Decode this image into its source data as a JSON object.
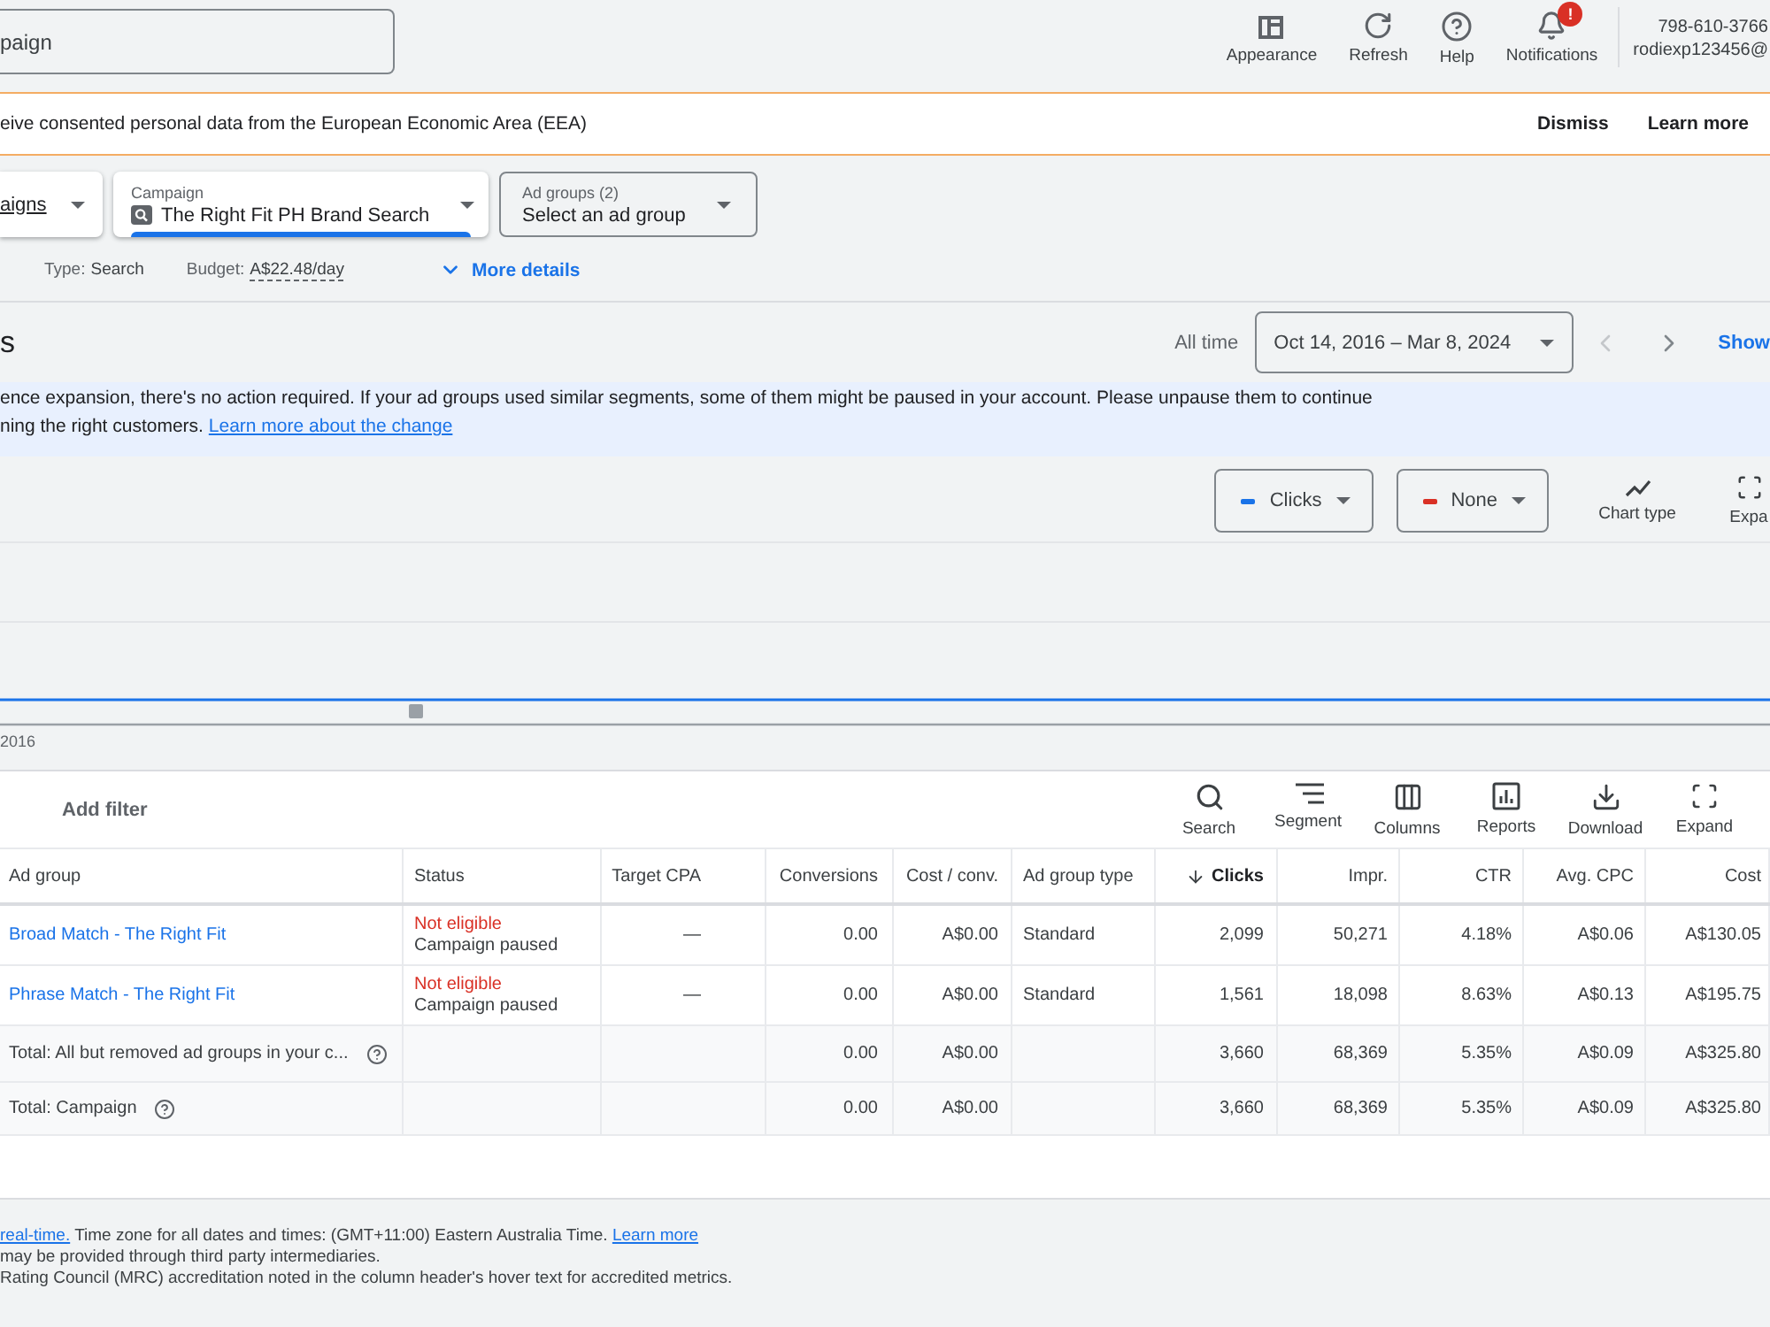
{
  "top_bar": {
    "search": {
      "value": "paign"
    },
    "actions": [
      {
        "label": "Appearance"
      },
      {
        "label": "Refresh"
      },
      {
        "label": "Help"
      },
      {
        "label": "Notifications",
        "badge": "!"
      }
    ],
    "account": {
      "customer_id": "798-610-3766",
      "email": "rodiexp123456@"
    }
  },
  "consent_banner": {
    "text": "eive consented personal data from the European Economic Area (EEA)",
    "actions": [
      "Dismiss",
      "Learn more"
    ]
  },
  "selectors": [
    {
      "kind": "link",
      "value": "aigns",
      "selected": false
    },
    {
      "kind": "chosen",
      "label": "Campaign",
      "value": "The Right Fit PH Brand Search",
      "selected": true
    },
    {
      "kind": "empty",
      "label": "Ad groups (2)",
      "value": "Select an ad group",
      "selected": false
    }
  ],
  "campaign_info": {
    "items": [
      {
        "kind": "text",
        "label": "Type:",
        "value": "Search"
      },
      {
        "kind": "editable",
        "label": "Budget:",
        "value": "A$22.48/day"
      }
    ],
    "more_details": "More details"
  },
  "page_header": {
    "title": "s",
    "range_label": "All time",
    "date_range": "Oct 14, 2016 – Mar 8, 2024",
    "prev_disabled": true,
    "next_disabled": false,
    "show": "Show"
  },
  "notice": {
    "lines": [
      "ence expansion, there's no action required. If your ad groups used similar segments, some of them might be paused in your account. Please unpause them to continue",
      "ning the right customers."
    ],
    "link": "Learn more about the change"
  },
  "chart": {
    "metrics": [
      {
        "label": "Clicks",
        "color": "#1a73e8"
      },
      {
        "label": "None",
        "color": "#d93025"
      }
    ],
    "tools": [
      "Chart type",
      "Expa"
    ],
    "x_labels": [
      "2016"
    ]
  },
  "table": {
    "filter": "Add filter",
    "tools": [
      "Search",
      "Segment",
      "Columns",
      "Reports",
      "Download",
      "Expand"
    ],
    "columns": [
      {
        "label": "Ad group",
        "sorted": false
      },
      {
        "label": "Status",
        "sorted": false
      },
      {
        "label": "Target CPA",
        "sorted": false
      },
      {
        "label": "Conversions",
        "sorted": false
      },
      {
        "label": "Cost / conv.",
        "sorted": false
      },
      {
        "label": "Ad group type",
        "sorted": false
      },
      {
        "label": "Clicks",
        "sorted": true
      },
      {
        "label": "Impr.",
        "sorted": false
      },
      {
        "label": "CTR",
        "sorted": false
      },
      {
        "label": "Avg. CPC",
        "sorted": false
      },
      {
        "label": "Cost",
        "sorted": false
      }
    ],
    "rows": [
      {
        "kind": "ad_group",
        "name": "Broad Match - The Right Fit",
        "status": "Not eligible",
        "status_reason": "Campaign paused",
        "target_cpa": "—",
        "conversions": "0.00",
        "cost_per_conv": "A$0.00",
        "ad_group_type": "Standard",
        "clicks": "2,099",
        "impr": "50,271",
        "ctr": "4.18%",
        "avg_cpc": "A$0.06",
        "cost": "A$130.05"
      },
      {
        "kind": "ad_group",
        "name": "Phrase Match - The Right Fit",
        "status": "Not eligible",
        "status_reason": "Campaign paused",
        "target_cpa": "—",
        "conversions": "0.00",
        "cost_per_conv": "A$0.00",
        "ad_group_type": "Standard",
        "clicks": "1,561",
        "impr": "18,098",
        "ctr": "8.63%",
        "avg_cpc": "A$0.13",
        "cost": "A$195.75"
      },
      {
        "kind": "total",
        "name": "Total: All but removed ad groups in your c...",
        "conversions": "0.00",
        "cost_per_conv": "A$0.00",
        "clicks": "3,660",
        "impr": "68,369",
        "ctr": "5.35%",
        "avg_cpc": "A$0.09",
        "cost": "A$325.80"
      },
      {
        "kind": "total",
        "name": "Total: Campaign",
        "conversions": "0.00",
        "cost_per_conv": "A$0.00",
        "clicks": "3,660",
        "impr": "68,369",
        "ctr": "5.35%",
        "avg_cpc": "A$0.09",
        "cost": "A$325.80"
      }
    ]
  },
  "footer": {
    "notes": [
      {
        "lead_link": "real-time.",
        "text": "Time zone for all dates and times: (GMT+11:00) Eastern Australia Time.",
        "link": "Learn more"
      },
      {
        "text": "may be provided through third party intermediaries."
      },
      {
        "text": "Rating Council (MRC) accreditation noted in the column header's hover text for accredited metrics."
      }
    ]
  }
}
